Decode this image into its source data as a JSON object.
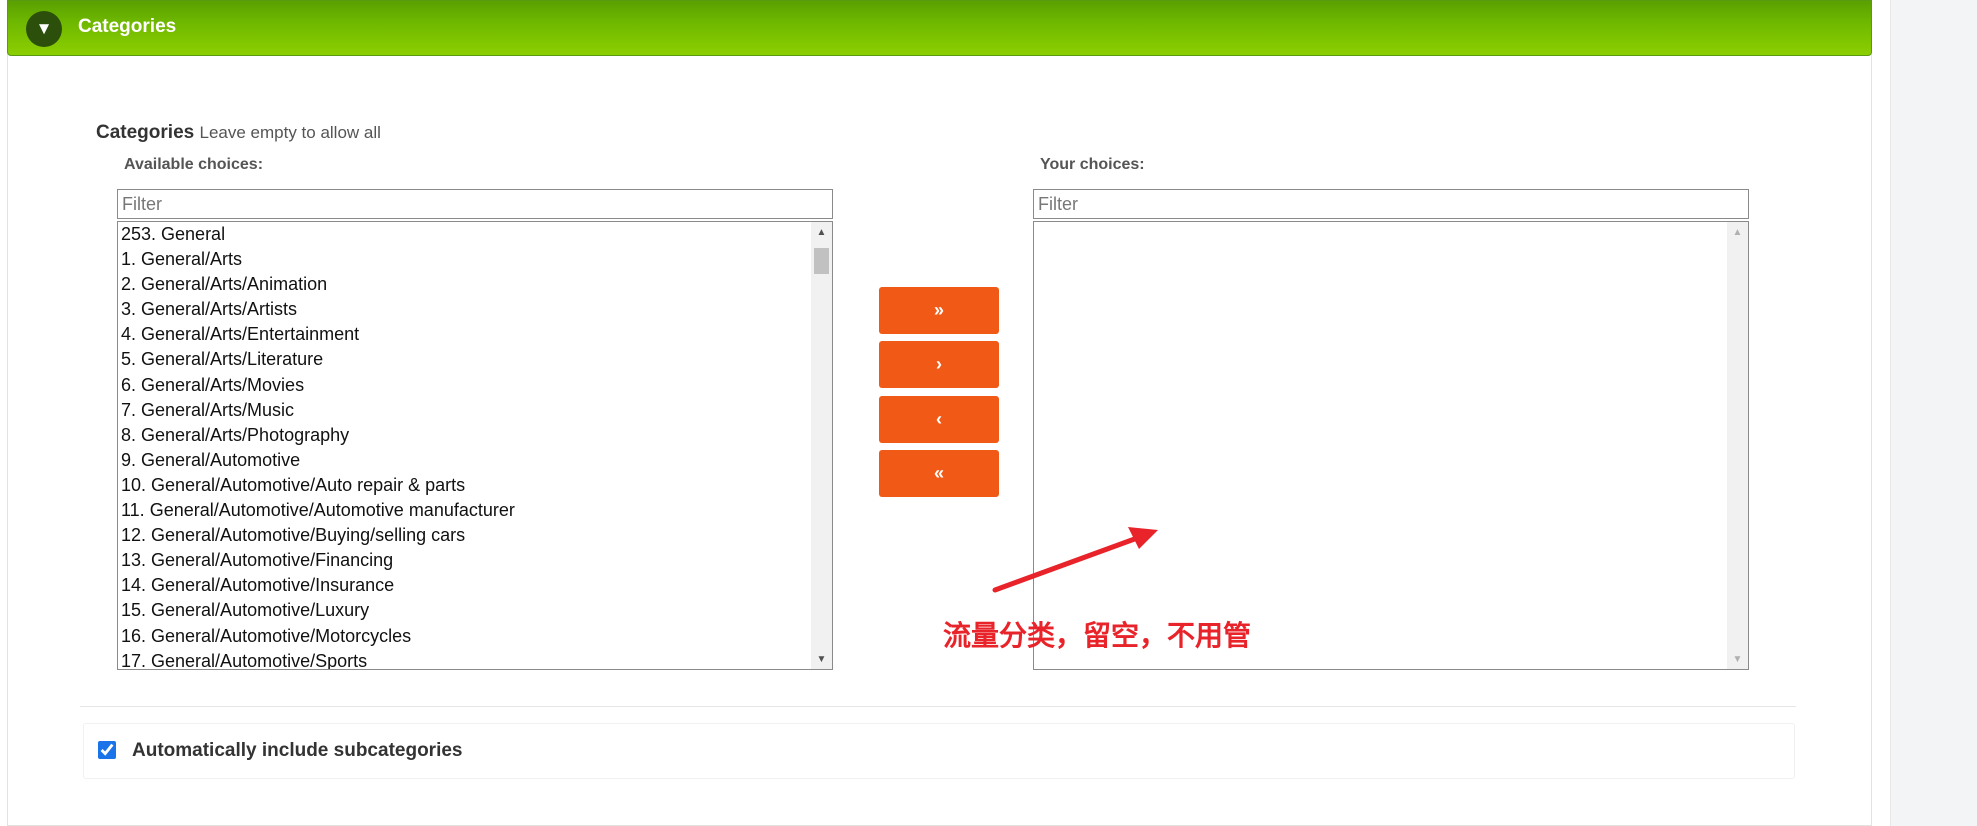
{
  "panel": {
    "title": "Categories",
    "toggle_glyph": "▼"
  },
  "field": {
    "label": "Categories",
    "hint": "Leave empty to allow all"
  },
  "available": {
    "label": "Available choices:",
    "filter_placeholder": "Filter",
    "options": [
      "253. General",
      "1. General/Arts",
      "2. General/Arts/Animation",
      "3. General/Arts/Artists",
      "4. General/Arts/Entertainment",
      "5. General/Arts/Literature",
      "6. General/Arts/Movies",
      "7. General/Arts/Music",
      "8. General/Arts/Photography",
      "9. General/Automotive",
      "10. General/Automotive/Auto repair & parts",
      "11. General/Automotive/Automotive manufacturer",
      "12. General/Automotive/Buying/selling cars",
      "13. General/Automotive/Financing",
      "14. General/Automotive/Insurance",
      "15. General/Automotive/Luxury",
      "16. General/Automotive/Motorcycles",
      "17. General/Automotive/Sports"
    ]
  },
  "chosen": {
    "label": "Your choices:",
    "filter_placeholder": "Filter",
    "options": []
  },
  "buttons": {
    "add_all": "»",
    "add": "›",
    "remove": "‹",
    "remove_all": "«"
  },
  "annotation": {
    "text": "流量分类，留空，不用管",
    "color": "#e8232a"
  },
  "subcategories": {
    "label": "Automatically include subcategories",
    "checked": true
  },
  "colors": {
    "header_green": "#6fb800",
    "button_orange": "#f15a16"
  },
  "icons": {
    "toggle": "chevron-down-icon",
    "scroll_up": "scroll-up-arrow-icon",
    "scroll_down": "scroll-down-arrow-icon",
    "annotation_arrow": "arrow-icon"
  }
}
